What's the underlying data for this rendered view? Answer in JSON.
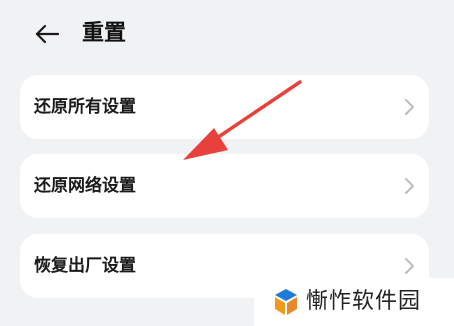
{
  "header": {
    "title": "重置",
    "back_icon": "arrow-left-icon"
  },
  "settings": {
    "items": [
      {
        "label": "还原所有设置",
        "icon": "chevron-right-icon"
      },
      {
        "label": "还原网络设置",
        "icon": "chevron-right-icon"
      },
      {
        "label": "恢复出厂设置",
        "icon": "chevron-right-icon"
      }
    ]
  },
  "annotation": {
    "color": "#e8403a",
    "points_to": "还原网络设置"
  },
  "watermark": {
    "text": "慚怍软件园",
    "logo_colors": [
      "#1f7ad8",
      "#f39a1c"
    ]
  },
  "colors": {
    "background": "#f1f2f4",
    "card": "#ffffff",
    "text": "#1a1a1a",
    "chevron": "#b9bcc1"
  }
}
